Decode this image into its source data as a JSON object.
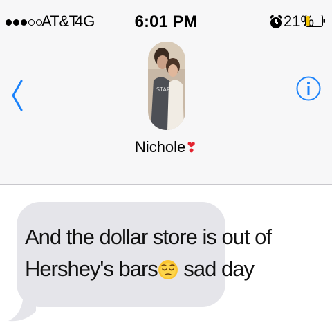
{
  "status_bar": {
    "signal_filled": 3,
    "signal_total": 5,
    "carrier": "AT&T",
    "network": "4G",
    "time": "6:01 PM",
    "alarm_icon": "alarm-clock-icon",
    "battery_percent": "21%",
    "battery_level": 0.21,
    "battery_color": "#f5c400"
  },
  "nav": {
    "back_icon": "chevron-left-icon",
    "info_icon": "info-icon",
    "accent_color": "#1a82fb"
  },
  "contact": {
    "name": "Nichole",
    "name_emoji": "❣",
    "avatar_icon": "contact-photo"
  },
  "messages": [
    {
      "direction": "incoming",
      "lines": [
        "And the dollar store is out of",
        "Hershey's bars"
      ],
      "emoji": "pensive-face-emoji",
      "tail_text": " sad day"
    }
  ]
}
